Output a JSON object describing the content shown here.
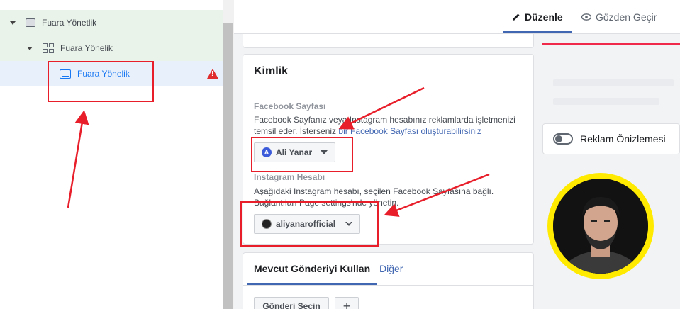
{
  "tree": {
    "campaign_label": "Fuara Yönetlik",
    "adset_label": "Fuara Yönelik",
    "ad_label": "Fuara Yönelik"
  },
  "header": {
    "edit_tab": "Düzenle",
    "preview_tab": "Gözden Geçir"
  },
  "identity": {
    "title": "Kimlik",
    "facebook_page_label": "Facebook Sayfası",
    "facebook_page_desc": "Facebook Sayfanız veya Instagram hesabınız reklamlarda işletmenizi temsil eder. İsterseniz ",
    "facebook_page_link": "bir Facebook Sayfası oluşturabilirsiniz",
    "facebook_page_value": "Ali Yanar",
    "instagram_label": "Instagram Hesabı",
    "instagram_desc": "Aşağıdaki Instagram hesabı, seçilen Facebook Sayfasına bağlı. Bağlantıları Page settings'nde yönetin.",
    "instagram_value": "aliyanarofficial"
  },
  "post": {
    "active_tab": "Mevcut Gönderiyi Kullan",
    "other_tab": "Diğer",
    "select_post_button": "Gönderi Seçin",
    "add_button": "+"
  },
  "preview": {
    "toggle_label": "Reklam Önizlemesi"
  },
  "colors": {
    "accent": "#4267b2",
    "link": "#1877f2",
    "annotation_red": "#e81e2a",
    "avatar_ring": "#ffea00"
  }
}
